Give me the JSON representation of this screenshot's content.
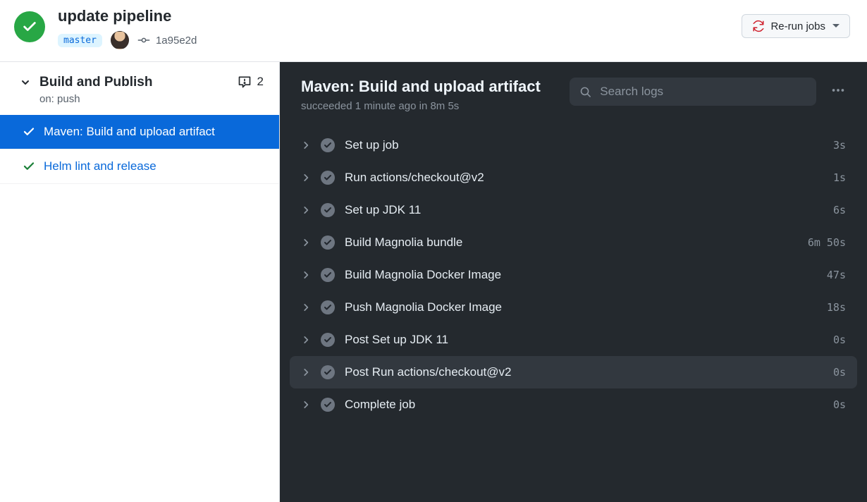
{
  "header": {
    "title": "update pipeline",
    "branch": "master",
    "commit_sha": "1a95e2d",
    "rerun_label": "Re-run jobs"
  },
  "workflow": {
    "name": "Build and Publish",
    "trigger_line": "on: push",
    "annotation_count": "2"
  },
  "jobs": [
    {
      "name": "Maven: Build and upload artifact",
      "selected": true
    },
    {
      "name": "Helm lint and release",
      "selected": false
    }
  ],
  "log": {
    "job_title": "Maven: Build and upload artifact",
    "subtext": "succeeded 1 minute ago in 8m 5s",
    "search_placeholder": "Search logs"
  },
  "steps": [
    {
      "name": "Set up job",
      "dur": "3s",
      "hover": false
    },
    {
      "name": "Run actions/checkout@v2",
      "dur": "1s",
      "hover": false
    },
    {
      "name": "Set up JDK 11",
      "dur": "6s",
      "hover": false
    },
    {
      "name": "Build Magnolia bundle",
      "dur": "6m 50s",
      "hover": false
    },
    {
      "name": "Build Magnolia Docker Image",
      "dur": "47s",
      "hover": false
    },
    {
      "name": "Push Magnolia Docker Image",
      "dur": "18s",
      "hover": false
    },
    {
      "name": "Post Set up JDK 11",
      "dur": "0s",
      "hover": false
    },
    {
      "name": "Post Run actions/checkout@v2",
      "dur": "0s",
      "hover": true
    },
    {
      "name": "Complete job",
      "dur": "0s",
      "hover": false
    }
  ],
  "colors": {
    "success": "#28a745",
    "link": "#0969da",
    "panel": "#24292e",
    "panel_hover": "#32383f"
  }
}
